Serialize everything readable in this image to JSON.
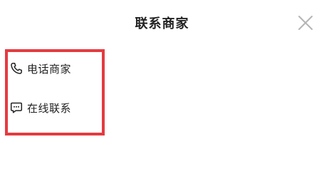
{
  "dialog": {
    "title": "联系商家",
    "close_icon": "close-icon"
  },
  "options": [
    {
      "label": "电话商家",
      "icon": "phone-icon"
    },
    {
      "label": "在线联系",
      "icon": "chat-icon"
    }
  ],
  "colors": {
    "highlight_border": "#e53a40",
    "text": "#222222",
    "close": "#b5b5b5"
  }
}
